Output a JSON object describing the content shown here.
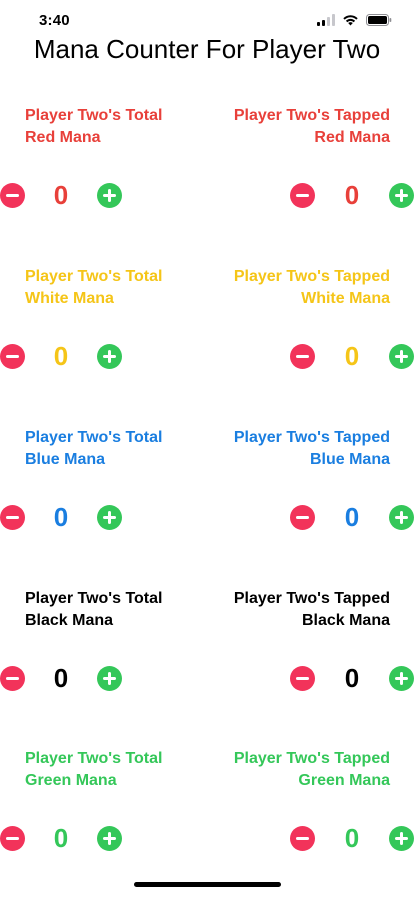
{
  "status_bar": {
    "time": "3:40",
    "icons": [
      "cellular-signal-icon",
      "wifi-icon",
      "battery-icon"
    ]
  },
  "title": "Mana Counter For Player Two",
  "colors": {
    "red": "#e8403a",
    "white": "#f5c518",
    "blue": "#1a7ee0",
    "black": "#000000",
    "green": "#34c759",
    "minus_button": "#f2335a",
    "plus_button": "#34c759"
  },
  "rows": [
    {
      "color": "red",
      "total_label": [
        "Player Two's Total",
        "Red Mana"
      ],
      "tapped_label": [
        "Player Two's Tapped",
        "Red Mana"
      ],
      "total_value": "0",
      "tapped_value": "0"
    },
    {
      "color": "white",
      "total_label": [
        "Player Two's Total",
        "White Mana"
      ],
      "tapped_label": [
        "Player Two's Tapped",
        "White Mana"
      ],
      "total_value": "0",
      "tapped_value": "0"
    },
    {
      "color": "blue",
      "total_label": [
        "Player Two's Total",
        "Blue Mana"
      ],
      "tapped_label": [
        "Player Two's Tapped",
        "Blue Mana"
      ],
      "total_value": "0",
      "tapped_value": "0"
    },
    {
      "color": "black",
      "total_label": [
        "Player Two's Total",
        "Black Mana"
      ],
      "tapped_label": [
        "Player Two's Tapped",
        "Black Mana"
      ],
      "total_value": "0",
      "tapped_value": "0"
    },
    {
      "color": "green",
      "total_label": [
        "Player Two's Total",
        "Green Mana"
      ],
      "tapped_label": [
        "Player Two's Tapped",
        "Green Mana"
      ],
      "total_value": "0",
      "tapped_value": "0"
    }
  ]
}
